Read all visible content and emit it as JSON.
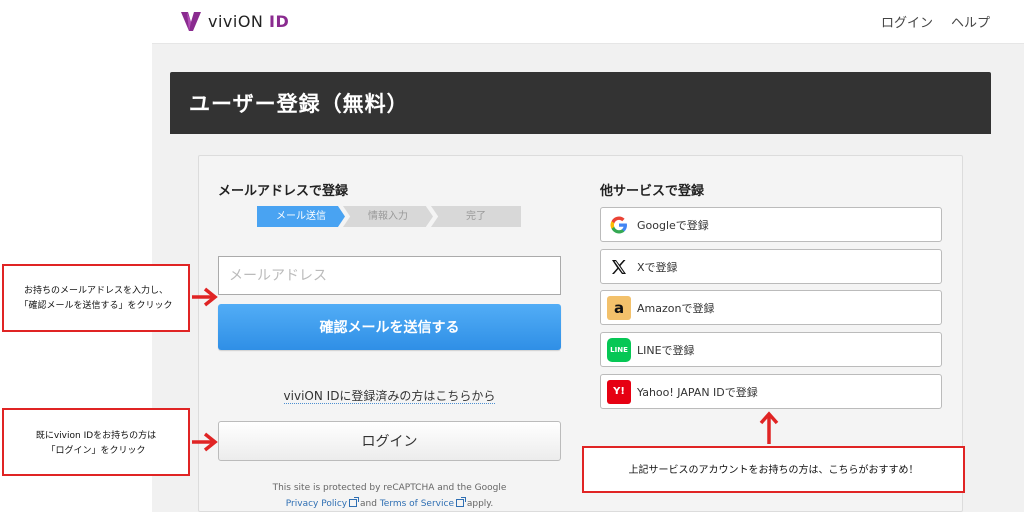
{
  "header": {
    "logo_prefix": "viviON",
    "logo_suffix": "ID",
    "nav": {
      "login": "ログイン",
      "help": "ヘルプ"
    }
  },
  "page_title": "ユーザー登録（無料）",
  "email_section": {
    "title": "メールアドレスで登録",
    "steps": [
      "メール送信",
      "情報入力",
      "完了"
    ],
    "email_placeholder": "メールアドレス",
    "send_button": "確認メールを送信する",
    "login_prompt": "viviON IDに登録済みの方はこちらから",
    "login_button": "ログイン",
    "recaptcha_text": "This site is protected by reCAPTCHA and the Google",
    "privacy_policy": "Privacy Policy",
    "and": "and",
    "terms": "Terms of Service",
    "apply": "apply."
  },
  "social_section": {
    "title": "他サービスで登録",
    "buttons": [
      {
        "label": "Googleで登録",
        "icon": "google-icon"
      },
      {
        "label": "Xで登録",
        "icon": "x-icon"
      },
      {
        "label": "Amazonで登録",
        "icon": "amazon-icon"
      },
      {
        "label": "LINEで登録",
        "icon": "line-icon"
      },
      {
        "label": "Yahoo! JAPAN IDで登録",
        "icon": "yahoo-icon"
      }
    ]
  },
  "annotations": {
    "email_note_line1": "お持ちのメールアドレスを入力し、",
    "email_note_line2": "「確認メールを送信する」をクリック",
    "login_note_line1": "既にvivion IDをお持ちの方は",
    "login_note_line2": "「ログイン」をクリック",
    "social_note": "上記サービスのアカウントをお持ちの方は、こちらがおすすめ！"
  },
  "colors": {
    "accent_blue": "#3a97ea",
    "title_bar": "#333333",
    "annotation_red": "#e02424",
    "logo_purple": "#8a2b8f"
  }
}
